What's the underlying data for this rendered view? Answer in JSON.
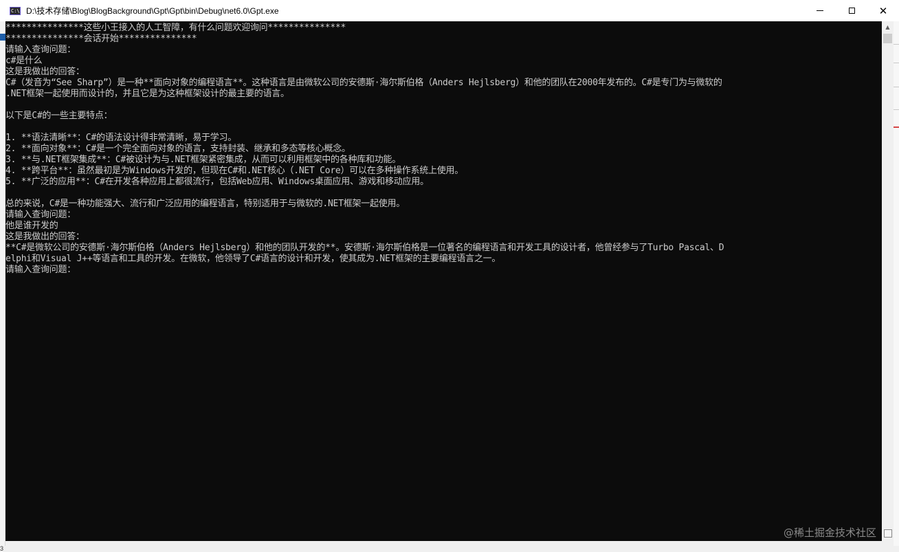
{
  "window": {
    "title": "D:\\技术存储\\Blog\\BlogBackground\\Gpt\\Gpt\\bin\\Debug\\net6.0\\Gpt.exe",
    "icon": "console-app-icon",
    "icon_text": "C:\\"
  },
  "console": {
    "background": "#0c0c0c",
    "foreground": "#cccccc",
    "lines": [
      "***************这些小王接入的人工智障，有什么问题欢迎询问***************",
      "***************会话开始***************",
      "请输入查询问题：",
      "c#是什么",
      "这是我做出的回答：",
      "C#（发音为“See Sharp”）是一种**面向对象的编程语言**。这种语言是由微软公司的安德斯·海尔斯伯格（Anders Hejlsberg）和他的团队在2000年发布的。C#是专门为与微软的",
      ".NET框架一起使用而设计的，并且它是为这种框架设计的最主要的语言。",
      "",
      "以下是C#的一些主要特点：",
      "",
      "1. **语法清晰**：C#的语法设计得非常清晰，易于学习。",
      "2. **面向对象**：C#是一个完全面向对象的语言，支持封装、继承和多态等核心概念。",
      "3. **与.NET框架集成**：C#被设计为与.NET框架紧密集成，从而可以利用框架中的各种库和功能。",
      "4. **跨平台**：虽然最初是为Windows开发的，但现在C#和.NET核心（.NET Core）可以在多种操作系统上使用。",
      "5. **广泛的应用**：C#在开发各种应用上都很流行，包括Web应用、Windows桌面应用、游戏和移动应用。",
      "",
      "总的来说，C#是一种功能强大、流行和广泛应用的编程语言，特别适用于与微软的.NET框架一起使用。",
      "请输入查询问题：",
      "他是谁开发的",
      "这是我做出的回答：",
      "**C#是微软公司的安德斯·海尔斯伯格（Anders Hejlsberg）和他的团队开发的**。安德斯·海尔斯伯格是一位著名的编程语言和开发工具的设计者，他曾经参与了Turbo Pascal、D",
      "elphi和Visual J++等语言和工具的开发。在微软，他领导了C#语言的设计和开发，使其成为.NET框架的主要编程语言之一。",
      "请输入查询问题："
    ]
  },
  "controls": {
    "minimize": "minimize",
    "maximize": "maximize",
    "close": "✕"
  },
  "scrollbar": {
    "up": "▲",
    "down": "▼"
  },
  "watermark": "@稀土掘金技术社区",
  "left_strip_number": "3"
}
